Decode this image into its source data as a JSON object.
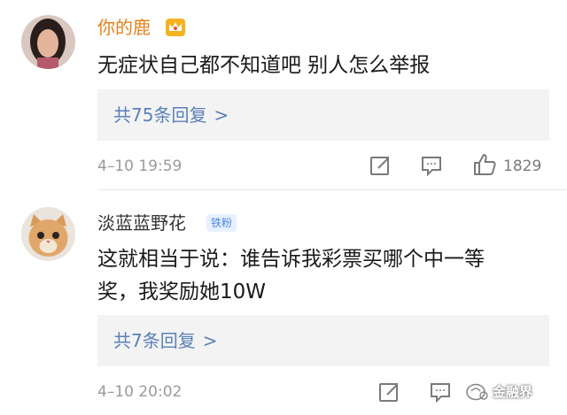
{
  "comments": [
    {
      "username": "你的鹿",
      "text": "无症状自己都不知道吧 别人怎么举报",
      "replies_label": "共75条回复",
      "replies_chevron": ">",
      "time": "4–10 19:59",
      "likes": "1829"
    },
    {
      "username": "淡蓝蓝野花",
      "badge": "铁粉",
      "text_line1": "这就相当于说：谁告诉我彩票买哪个中一等",
      "text_line2": "奖，我奖励她10W",
      "replies_label": "共7条回复",
      "replies_chevron": ">",
      "time": "4–10 20:02"
    }
  ],
  "watermark": "金融界",
  "colors": {
    "vip_name": "#e8801a",
    "link": "#5a80b8",
    "badge_bg": "#e6f0ff",
    "badge_text": "#4d8ae0",
    "reply_bg": "#f3f3f3"
  },
  "icons": [
    "crown-icon",
    "share-icon",
    "comment-icon",
    "like-icon"
  ]
}
